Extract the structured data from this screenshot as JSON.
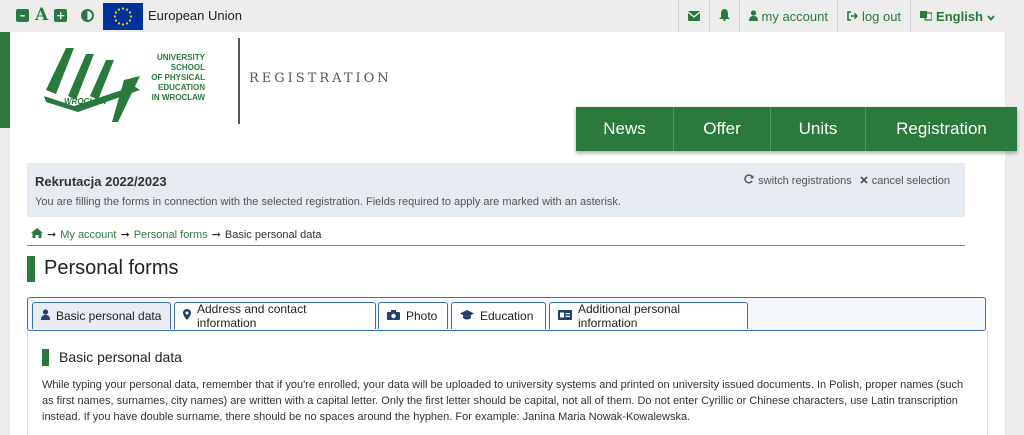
{
  "topbar": {
    "eu_label": "European Union",
    "icons": [
      "increase-font-icon",
      "font-size-icon",
      "contrast-icon"
    ],
    "items": {
      "my_account": "my account",
      "log_out": "log out",
      "language": "English"
    }
  },
  "header": {
    "logo_lines": [
      "UNIVERSITY",
      "SCHOOL",
      "OF PHYSICAL",
      "EDUCATION",
      "IN WROCLAW"
    ],
    "logo_city": "WROCLAW",
    "section_title": "REGISTRATION"
  },
  "nav": {
    "items": [
      {
        "label": "News"
      },
      {
        "label": "Offer"
      },
      {
        "label": "Units"
      },
      {
        "label": "Registration"
      }
    ]
  },
  "registration": {
    "title": "Rekrutacja 2022/2023",
    "description": "You are filling the forms in connection with the selected registration. Fields required to apply are marked with an asterisk.",
    "switch_label": "switch registrations",
    "cancel_label": "cancel selection"
  },
  "breadcrumb": {
    "items": [
      "My account",
      "Personal forms",
      "Basic personal data"
    ],
    "separator": "➞"
  },
  "page_title": "Personal forms",
  "tabs": [
    {
      "label": "Basic personal data",
      "icon": "user-icon",
      "active": true
    },
    {
      "label": "Address and contact information",
      "icon": "map-marker-icon",
      "active": false
    },
    {
      "label": "Photo",
      "icon": "camera-icon",
      "active": false
    },
    {
      "label": "Education",
      "icon": "graduation-cap-icon",
      "active": false
    },
    {
      "label": "Additional personal information",
      "icon": "id-card-icon",
      "active": false
    }
  ],
  "section": {
    "title": "Basic personal data",
    "text": "While typing your personal data, remember that if you're enrolled, your data will be uploaded to university systems and printed on university issued documents. In Polish, proper names (such as first names, surnames, city names) are written with a capital letter. Only the first letter should be capital, not all of them. Do not enter Cyrillic or Chinese characters, use Latin transcription instead. If you have double surname, there should be no spaces around the hyphen. For example: Janina Maria Nowak-Kowalewska."
  },
  "colors": {
    "brand_green": "#2b7a3d",
    "tab_border": "#3c6dbb",
    "eu_blue": "#003399",
    "reg_box_bg": "#e6eaf1"
  }
}
